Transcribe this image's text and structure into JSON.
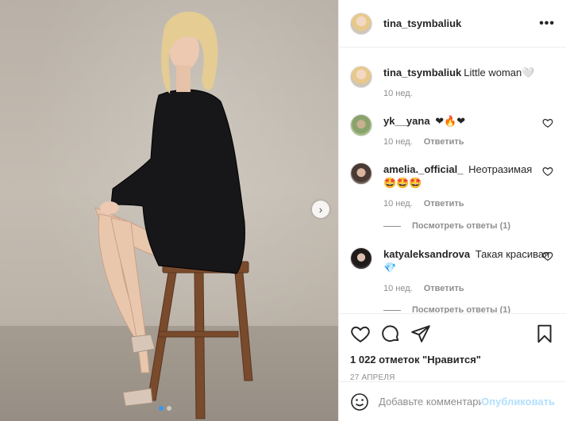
{
  "post": {
    "author": "tina_tsymbaliuk",
    "more_glyph": "•••",
    "carousel": {
      "next_glyph": "›",
      "slides": 2,
      "active_slide": 1
    }
  },
  "caption": {
    "username": "tina_tsymbaliuk",
    "text": "Little woman",
    "emoji": "🤍",
    "age": "10 нед."
  },
  "comments": [
    {
      "username": "yk__yana",
      "text": "",
      "emoji": "❤🔥❤",
      "age": "10 нед.",
      "reply": "Ответить",
      "view_replies": ""
    },
    {
      "username": "amelia._official_",
      "text": "Неотразимая",
      "emoji": "🤩🤩🤩",
      "age": "10 нед.",
      "reply": "Ответить",
      "view_replies": "Посмотреть ответы (1)"
    },
    {
      "username": "katyaleksandrova",
      "text": "Такая красивая",
      "emoji": "💎",
      "age": "10 нед.",
      "reply": "Ответить",
      "view_replies": "Посмотреть ответы (1)"
    }
  ],
  "actions": {
    "likes": "1 022 отметок \"Нравится\"",
    "date": "27 АПРЕЛЯ"
  },
  "add_comment": {
    "placeholder": "Добавьте комментарий...",
    "publish": "Опубликовать"
  },
  "colors": {
    "link_blue": "#3897f0",
    "publish_disabled": "#b2dffc",
    "muted": "#8e8e8e",
    "text": "#262626"
  },
  "icons": [
    "heart-icon",
    "comment-icon",
    "share-icon",
    "bookmark-icon",
    "emoji-icon",
    "chevron-right-icon",
    "more-icon"
  ]
}
